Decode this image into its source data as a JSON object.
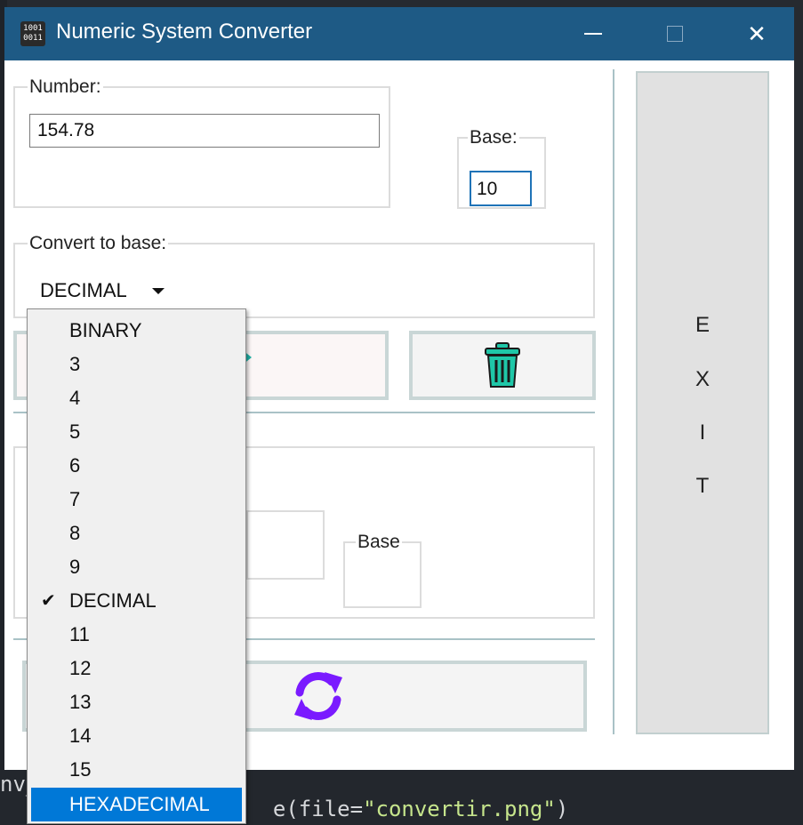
{
  "window": {
    "title": "Numeric System Converter",
    "icon_text": "1001 0011"
  },
  "number_group": {
    "label": "Number:",
    "value": "154.78"
  },
  "base_group": {
    "label": "Base:",
    "value": "10"
  },
  "convert_group": {
    "label": "Convert to base:",
    "selected": "DECIMAL"
  },
  "result_group": {
    "base_label": "Base"
  },
  "exit_button": {
    "letters": [
      "E",
      "X",
      "I",
      "T"
    ]
  },
  "dropdown": {
    "items": [
      "BINARY",
      "3",
      "4",
      "5",
      "6",
      "7",
      "8",
      "9",
      "DECIMAL",
      "11",
      "12",
      "13",
      "14",
      "15",
      "HEXADECIMAL"
    ],
    "checked": "DECIMAL",
    "highlighted": "HEXADECIMAL"
  },
  "background_code": {
    "prefix": "nv_",
    "line_text": "e(file=\"convertir.png\")",
    "string_part": "\"convertir.png\""
  },
  "colors": {
    "titlebar": "#1e5a85",
    "trash": "#1fc7a8",
    "refresh": "#7a1aff",
    "highlight": "#0078d7"
  },
  "icons": {
    "trash": "trash-icon",
    "refresh": "refresh-icon",
    "convert": "arrow-right-icon"
  }
}
